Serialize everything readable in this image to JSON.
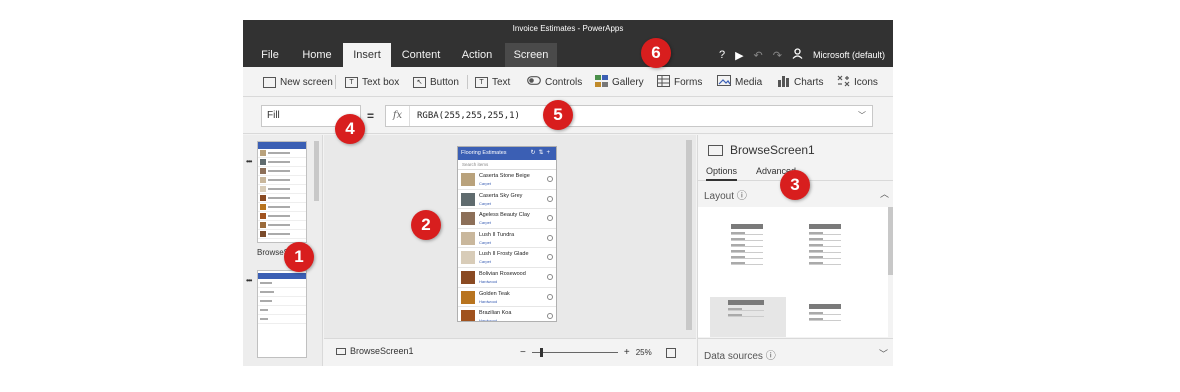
{
  "window": {
    "title": "Invoice Estimates - PowerApps"
  },
  "menu": {
    "tabs": [
      "File",
      "Home",
      "Insert",
      "Content",
      "Action",
      "Screen"
    ],
    "active_tab": "Insert",
    "help_icon": "?",
    "play_icon": "▶",
    "undo_icon": "↶",
    "redo_icon": "↷",
    "account_label": "Microsoft (default)"
  },
  "ribbon": {
    "new_screen": "New screen",
    "text_box": "Text box",
    "button": "Button",
    "text": "Text",
    "controls": "Controls",
    "gallery": "Gallery",
    "forms": "Forms",
    "media": "Media",
    "charts": "Charts",
    "icons": "Icons"
  },
  "formula_bar": {
    "property": "Fill",
    "equals": "=",
    "fx_label": "fx",
    "value": "RGBA(255,255,255,1)"
  },
  "screens_panel": {
    "screen1_label": "BrowseScreen1"
  },
  "app_preview": {
    "header": "Flooring Estimates",
    "search_placeholder": "Search items",
    "items": [
      {
        "title": "Caserta Stone Beige",
        "category": "Carpet",
        "color": "#b9a27c"
      },
      {
        "title": "Caserta Sky Grey",
        "category": "Carpet",
        "color": "#5f6b6e"
      },
      {
        "title": "Ageless Beauty Clay",
        "category": "Carpet",
        "color": "#8c6f58"
      },
      {
        "title": "Lush II Tundra",
        "category": "Carpet",
        "color": "#c9b79c"
      },
      {
        "title": "Lush II Frosty Glade",
        "category": "Carpet",
        "color": "#d8ccb8"
      },
      {
        "title": "Bolivian Rosewood",
        "category": "Hardwood",
        "color": "#8a4a22"
      },
      {
        "title": "Golden Teak",
        "category": "Hardwood",
        "color": "#b8741f"
      },
      {
        "title": "Brazilian Koa",
        "category": "Hardwood",
        "color": "#a0521e"
      }
    ]
  },
  "canvas_footer": {
    "screen_name": "BrowseScreen1",
    "zoom_minus": "−",
    "zoom_plus": "+",
    "zoom": "25%"
  },
  "properties_panel": {
    "title": "BrowseScreen1",
    "tab_options": "Options",
    "tab_advanced": "Advanced",
    "layout_label": "Layout",
    "data_sources_label": "Data sources"
  },
  "callouts": [
    "1",
    "2",
    "3",
    "4",
    "5",
    "6"
  ],
  "colors": {
    "chrome": "#323232",
    "accent": "#3b5fb4",
    "callout": "#d81e1e"
  }
}
